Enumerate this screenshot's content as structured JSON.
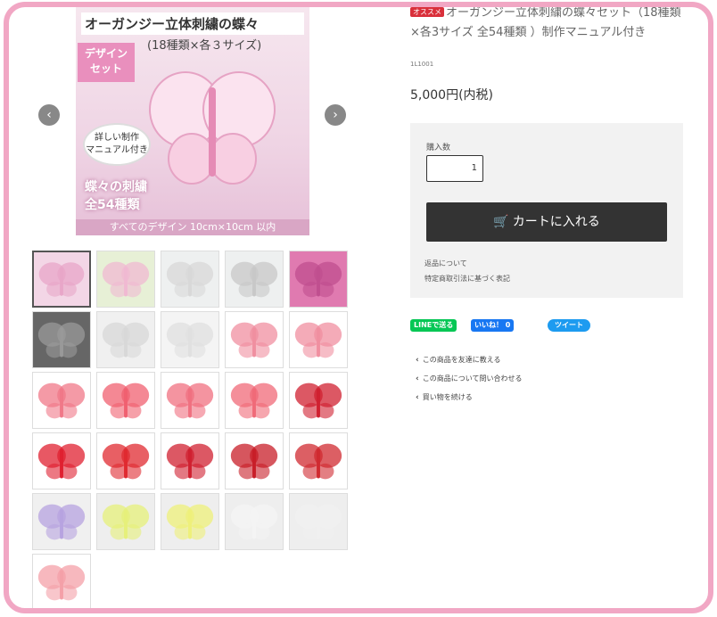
{
  "main_image": {
    "title": "オーガンジー立体刺繍の蝶々",
    "subtitle": "(18種類×各３サイズ)",
    "badge": "デザイン\nセット",
    "circle_note": "詳しい制作\nマニュアル付き",
    "bottom_text": "蝶々の刺繍\n全54種類",
    "footer": "すべてのデザイン 10cm×10cm 以内"
  },
  "gallery": {
    "prev_label": "‹",
    "next_label": "›"
  },
  "product": {
    "badge": "オススメ",
    "title": "オーガンジー立体刺繍の蝶々セット（18種類×各3サイズ 全54種類 ）制作マニュアル付き",
    "code": "1L1001",
    "price": "5,000円(内税)"
  },
  "cart": {
    "quantity_label": "購入数",
    "quantity_value": "1",
    "add_to_cart": "カートに入れる",
    "returns_link": "返品について",
    "tokusho_link": "特定商取引法に基づく表記"
  },
  "social": {
    "line": "LINEで送る",
    "facebook": "いいね！ 0",
    "twitter": "ツイート"
  },
  "actions": [
    "この商品を友達に教える",
    "この商品について問い合わせる",
    "買い物を続ける"
  ],
  "colors": {
    "frame": "#f1a7c4",
    "cart_button": "#333333",
    "line": "#06c755",
    "facebook": "#1877f2",
    "twitter": "#1d9bf0"
  }
}
